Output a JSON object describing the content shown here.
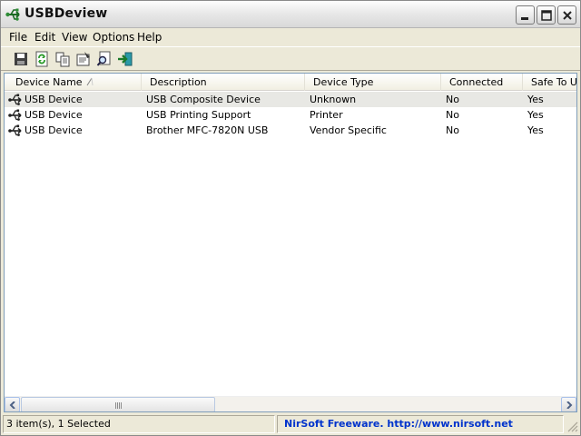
{
  "window": {
    "title": "USBDeview",
    "app_icon": "usb-icon"
  },
  "menu": [
    {
      "label": "File"
    },
    {
      "label": "Edit"
    },
    {
      "label": "View"
    },
    {
      "label": "Options"
    },
    {
      "label": "Help"
    }
  ],
  "toolbar": [
    {
      "icon": "save-icon"
    },
    {
      "icon": "refresh-icon"
    },
    {
      "icon": "copy-icon"
    },
    {
      "icon": "properties-icon"
    },
    {
      "icon": "find-icon"
    },
    {
      "icon": "exit-icon"
    }
  ],
  "table": {
    "columns": [
      {
        "label": "Device Name"
      },
      {
        "label": "Description"
      },
      {
        "label": "Device Type"
      },
      {
        "label": "Connected"
      },
      {
        "label": "Safe To Unplug"
      }
    ],
    "sort_column": "Device Name",
    "rows": [
      {
        "name": "USB Device",
        "description": "USB Composite Device",
        "type": "Unknown",
        "connected": "No",
        "safe": "Yes",
        "selected": true
      },
      {
        "name": "USB Device",
        "description": "USB Printing Support",
        "type": "Printer",
        "connected": "No",
        "safe": "Yes",
        "selected": false
      },
      {
        "name": "USB Device",
        "description": "Brother MFC-7820N USB",
        "type": "Vendor Specific",
        "connected": "No",
        "safe": "Yes",
        "selected": false
      }
    ]
  },
  "status": {
    "items": "3 item(s), 1 Selected",
    "link": "NirSoft Freeware.  http://www.nirsoft.net"
  },
  "colors": {
    "link": "#0033cc",
    "selected_row": "#e8e8e4",
    "icon_green": "#1a7a2a"
  }
}
